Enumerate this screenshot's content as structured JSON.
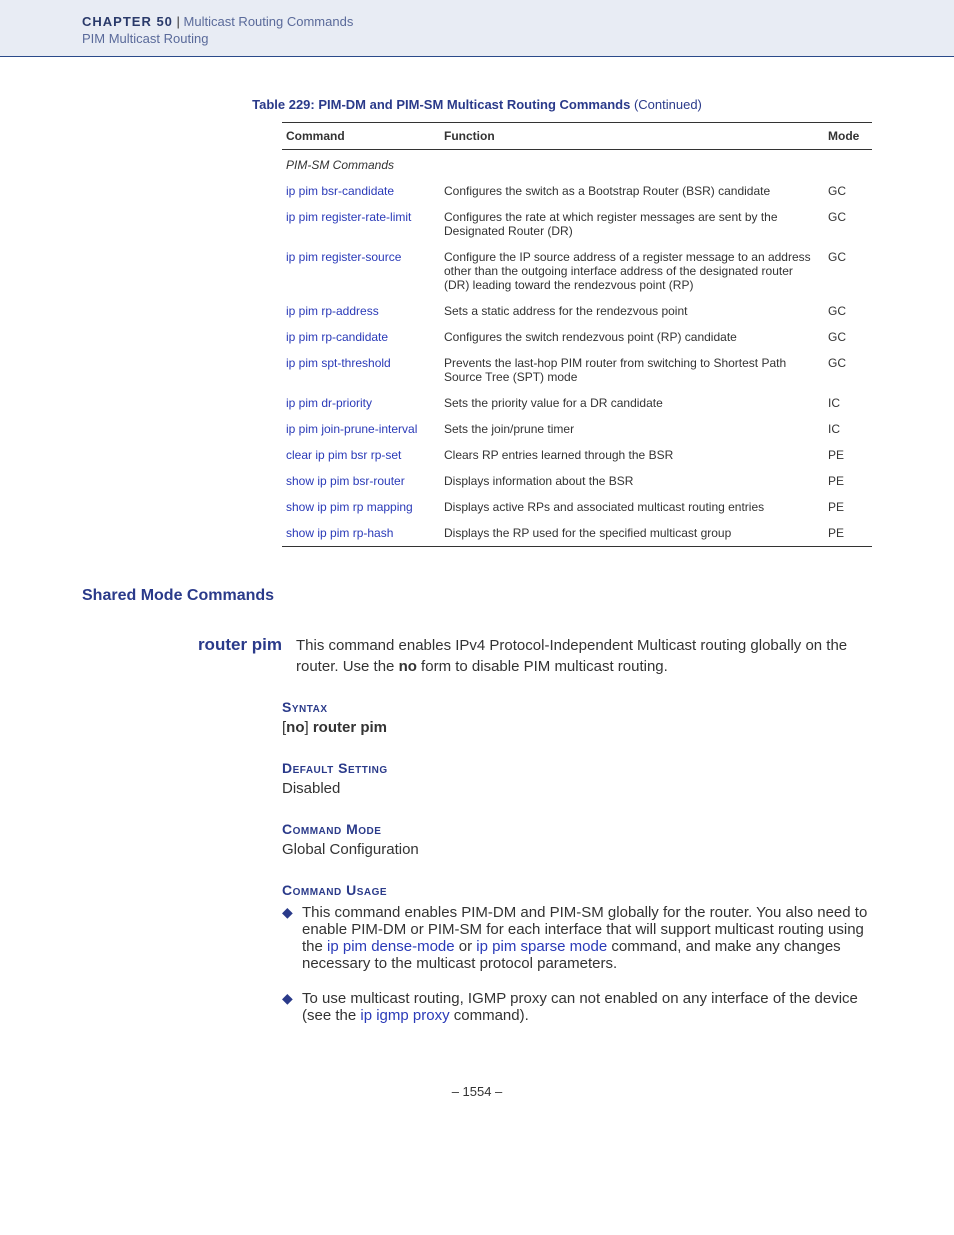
{
  "header": {
    "chapter_label": "CHAPTER 50",
    "divider": "  |  ",
    "chapter_title": "Multicast Routing Commands",
    "subtitle": "PIM Multicast Routing"
  },
  "table": {
    "caption_prefix": "Table 229: PIM-DM and PIM-SM Multicast Routing Commands",
    "caption_suffix": " (Continued)",
    "headers": {
      "command": "Command",
      "function": "Function",
      "mode": "Mode"
    },
    "subheader": "PIM-SM Commands",
    "rows": [
      {
        "cmd": "ip pim bsr-candidate",
        "func": "Configures the switch as a Bootstrap Router (BSR) candidate",
        "mode": "GC"
      },
      {
        "cmd": "ip pim register-rate-limit",
        "func": "Configures the rate at which register messages are sent by the Designated Router (DR)",
        "mode": "GC"
      },
      {
        "cmd": "ip pim register-source",
        "func": "Configure the IP source address of a register message to an address other than the outgoing interface address of the designated router (DR) leading toward the rendezvous point (RP)",
        "mode": "GC"
      },
      {
        "cmd": "ip pim rp-address",
        "func": "Sets a static address for the rendezvous point",
        "mode": "GC"
      },
      {
        "cmd": "ip pim rp-candidate",
        "func": "Configures the switch rendezvous point (RP) candidate",
        "mode": "GC"
      },
      {
        "cmd": "ip pim spt-threshold",
        "func": "Prevents the last-hop PIM router from switching to Shortest Path Source Tree (SPT) mode",
        "mode": "GC"
      },
      {
        "cmd": "ip pim dr-priority",
        "func": "Sets the priority value for a DR candidate",
        "mode": "IC"
      },
      {
        "cmd": "ip pim join-prune-interval",
        "func": "Sets the join/prune timer",
        "mode": "IC"
      },
      {
        "cmd": "clear ip pim bsr rp-set",
        "func": "Clears RP entries learned through the BSR",
        "mode": "PE"
      },
      {
        "cmd": "show ip pim bsr-router",
        "func": "Displays information about the BSR",
        "mode": "PE"
      },
      {
        "cmd": "show ip pim rp mapping",
        "func": "Displays active RPs and associated multicast routing entries",
        "mode": "PE"
      },
      {
        "cmd": "show ip pim rp-hash",
        "func": "Displays the RP used for the specified multicast group",
        "mode": "PE"
      }
    ]
  },
  "section_heading": "Shared Mode Commands",
  "command": {
    "name": "router pim",
    "desc_1": "This command enables IPv4 Protocol-Independent Multicast routing globally on the router. Use the ",
    "desc_no": "no",
    "desc_2": " form to disable PIM multicast routing."
  },
  "syntax": {
    "label": "Syntax",
    "body_open": "[",
    "body_no": "no",
    "body_close": "] ",
    "body_cmd": "router pim"
  },
  "default_setting": {
    "label": "Default Setting",
    "body": "Disabled"
  },
  "command_mode": {
    "label": "Command Mode",
    "body": "Global Configuration"
  },
  "usage": {
    "label": "Command Usage",
    "b1_1": "This command enables PIM-DM and PIM-SM globally for the router. You also need to enable PIM-DM or PIM-SM for each interface that will support multicast routing using the ",
    "b1_link1": "ip pim dense-mode",
    "b1_2": " or ",
    "b1_link2": "ip pim sparse mode",
    "b1_3": " command, and make any changes necessary to the multicast protocol parameters.",
    "b2_1": "To use multicast routing, IGMP proxy can not enabled on any interface of the device (see the ",
    "b2_link": "ip igmp proxy",
    "b2_2": " command)."
  },
  "footer": {
    "page": "–  1554  –"
  }
}
